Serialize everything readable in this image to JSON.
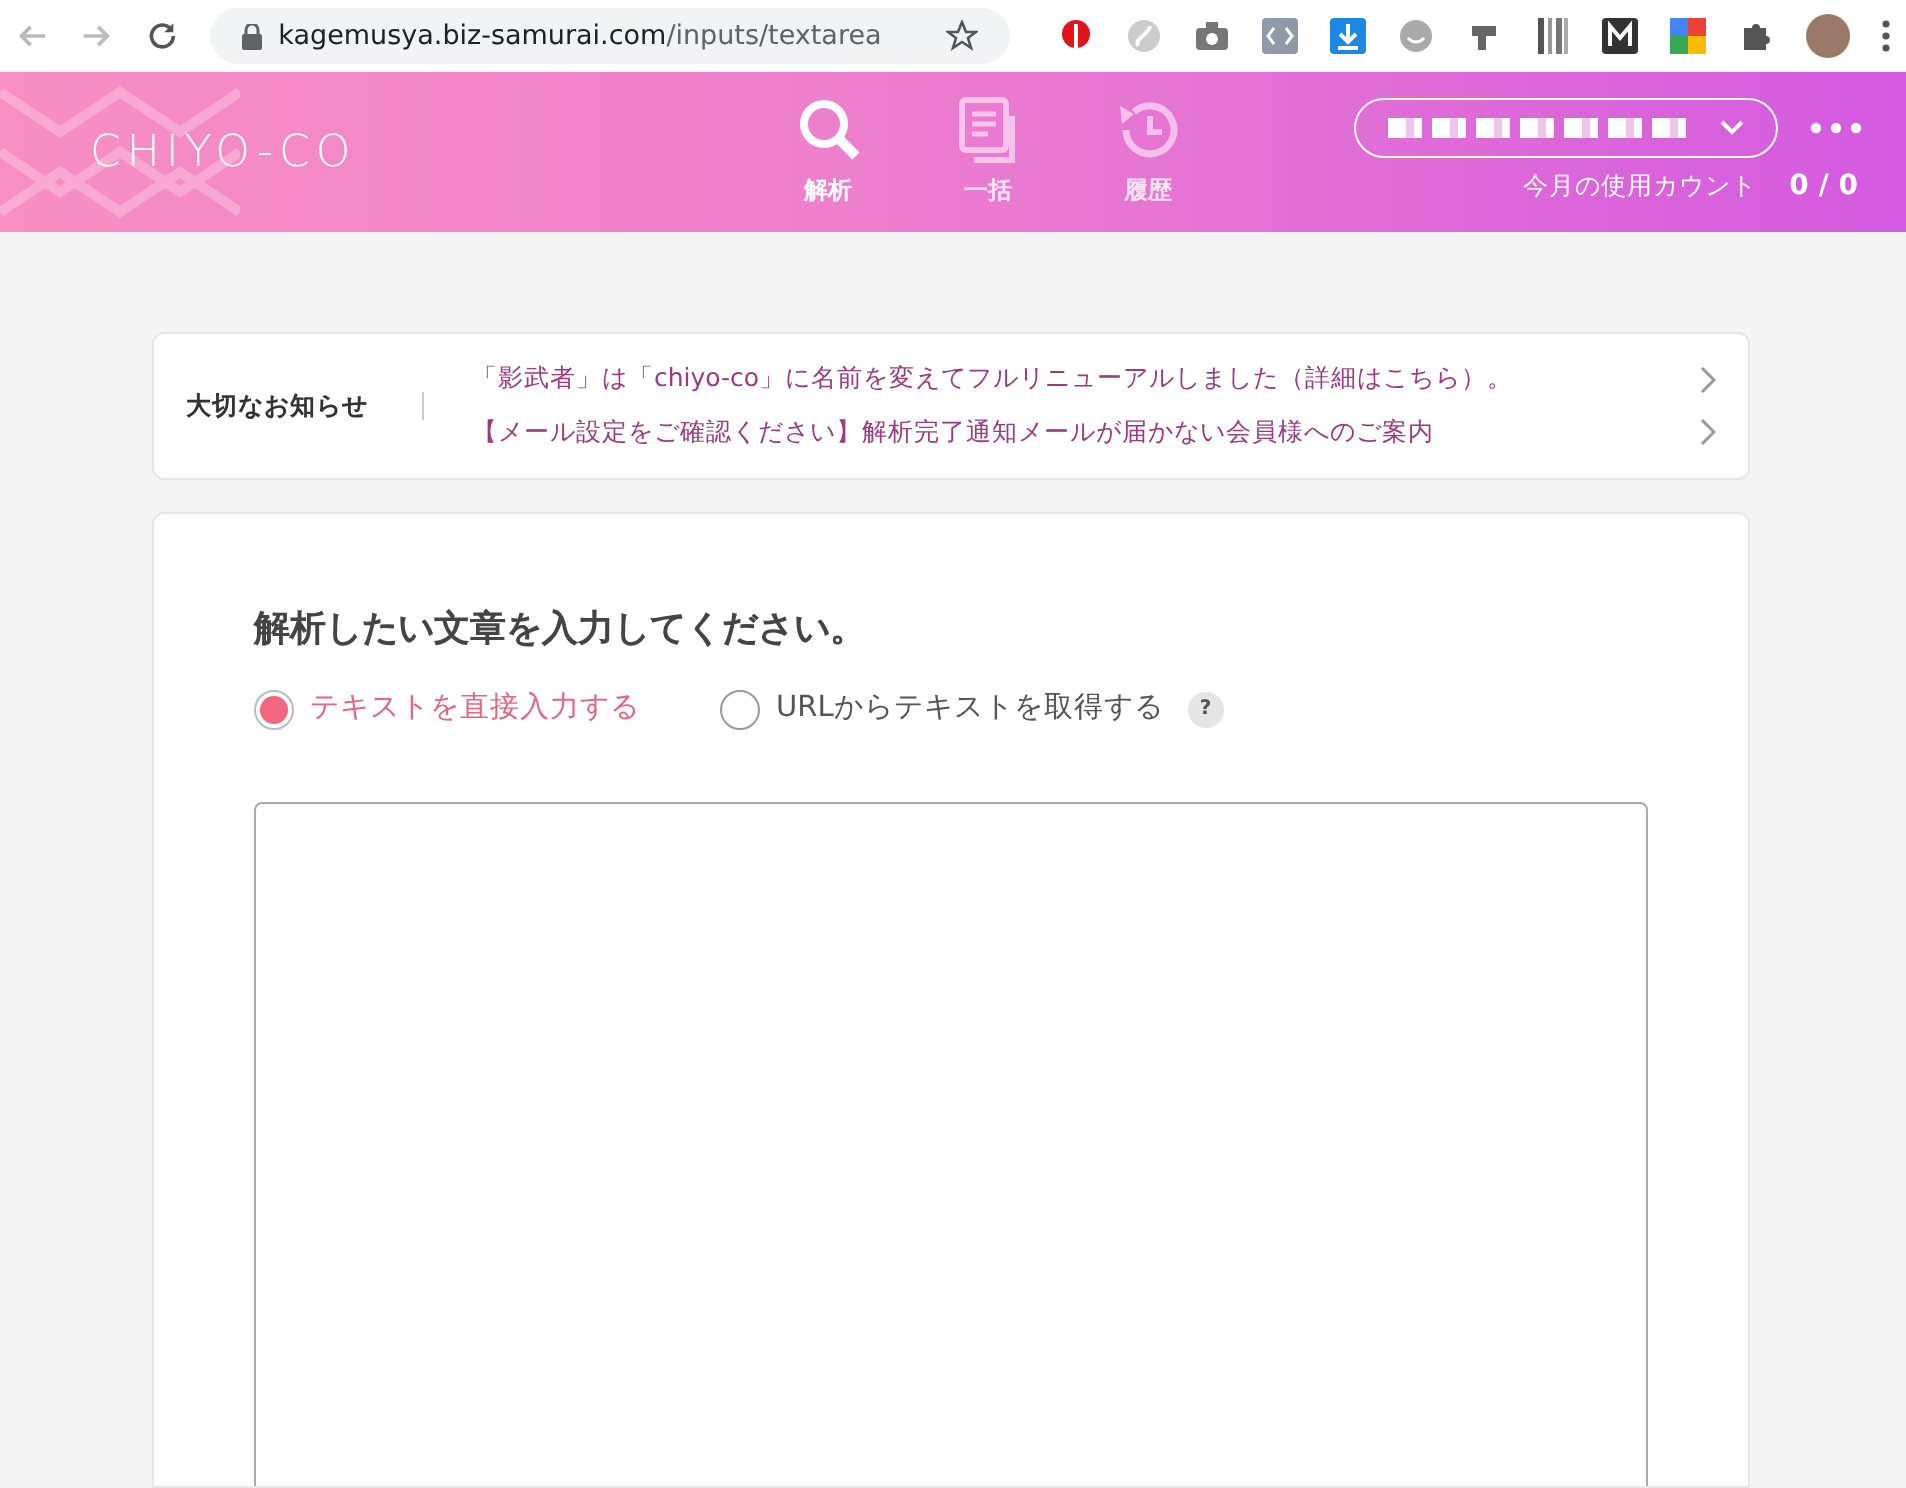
{
  "browser": {
    "url_host": "kagemusya.biz-samurai.com",
    "url_path": "/inputs/textarea"
  },
  "header": {
    "logo": "CHIYO-CO",
    "nav": [
      {
        "label": "解析",
        "selected": true,
        "kind": "search"
      },
      {
        "label": "一括",
        "selected": false,
        "kind": "document"
      },
      {
        "label": "履歴",
        "selected": false,
        "kind": "history"
      }
    ],
    "usage_label": "今月の使用カウント",
    "usage_count": "0 / 0"
  },
  "notices": {
    "heading": "大切なお知らせ",
    "items": [
      "「影武者」は「chiyo-co」に名前を変えてフルリニューアルしました（詳細はこちら）。",
      "【メール設定をご確認ください】解析完了通知メールが届かない会員様へのご案内"
    ]
  },
  "form": {
    "title": "解析したい文章を入力してください。",
    "options": [
      {
        "label": "テキストを直接入力する",
        "selected": true
      },
      {
        "label": "URLからテキストを取得する",
        "selected": false,
        "help": "?"
      }
    ]
  }
}
